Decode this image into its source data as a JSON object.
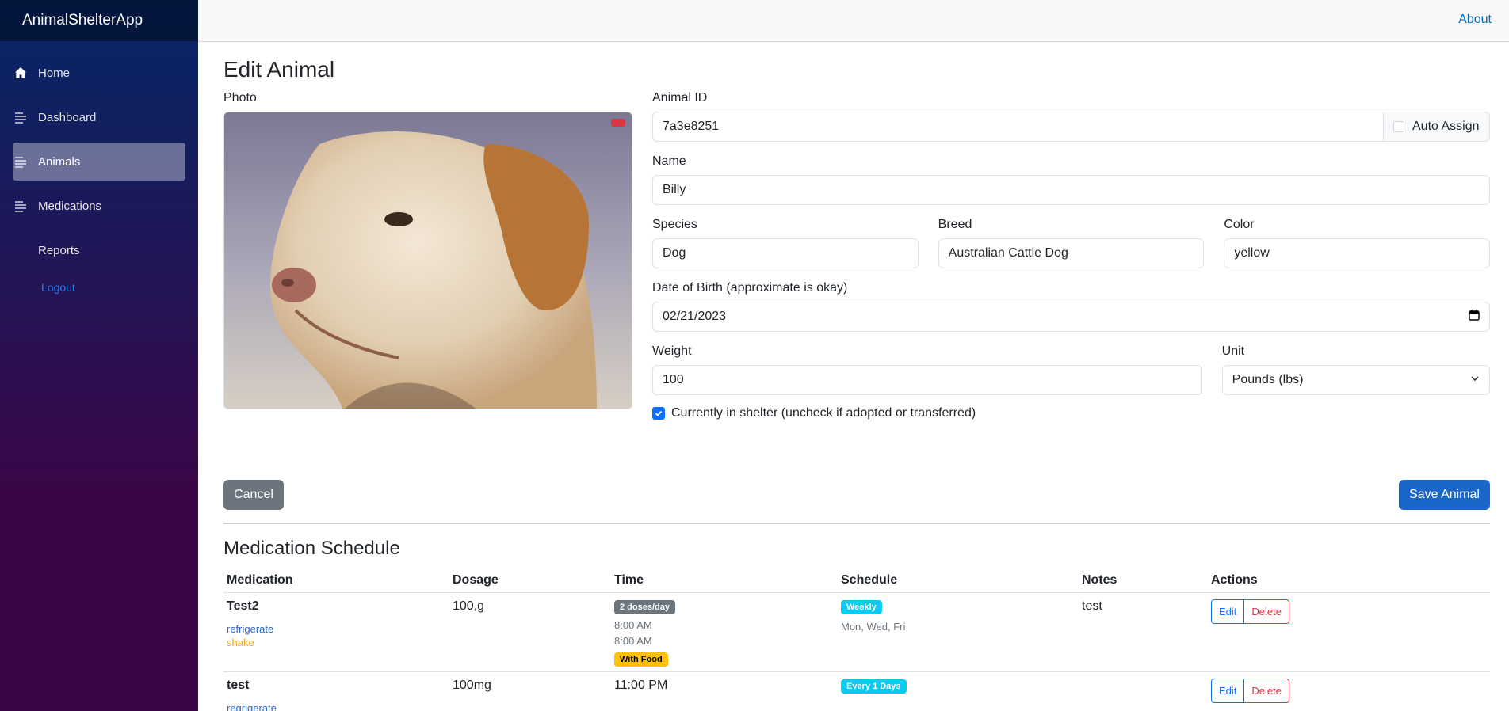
{
  "app": {
    "brand": "AnimalShelterApp"
  },
  "sidebar": {
    "items": [
      {
        "label": "Home",
        "icon": "home-icon"
      },
      {
        "label": "Dashboard",
        "icon": "list-icon"
      },
      {
        "label": "Animals",
        "icon": "list-icon",
        "active": true
      },
      {
        "label": "Medications",
        "icon": "list-icon"
      },
      {
        "label": "Reports",
        "icon": ""
      }
    ],
    "logout": "Logout"
  },
  "topbar": {
    "about": "About"
  },
  "page": {
    "title": "Edit Animal"
  },
  "form": {
    "photo_label": "Photo",
    "animal_id_label": "Animal ID",
    "animal_id_value": "7a3e8251",
    "auto_assign_label": "Auto Assign",
    "name_label": "Name",
    "name_value": "Billy",
    "species_label": "Species",
    "species_value": "Dog",
    "breed_label": "Breed",
    "breed_value": "Australian Cattle Dog",
    "color_label": "Color",
    "color_value": "yellow",
    "dob_label": "Date of Birth (approximate is okay)",
    "dob_value": "02/21/2023",
    "weight_label": "Weight",
    "weight_value": "100",
    "unit_label": "Unit",
    "unit_value": "Pounds (lbs)",
    "in_shelter_label": "Currently in shelter (uncheck if adopted or transferred)",
    "in_shelter_checked": true,
    "cancel_label": "Cancel",
    "save_label": "Save Animal"
  },
  "medications": {
    "title": "Medication Schedule",
    "headers": [
      "Medication",
      "Dosage",
      "Time",
      "Schedule",
      "Notes",
      "Actions"
    ],
    "rows": [
      {
        "name": "Test2",
        "instructions": [
          "refrigerate",
          "shake"
        ],
        "dosage": "100,g",
        "time_badge": "2 doses/day",
        "times": [
          "8:00 AM",
          "8:00 AM"
        ],
        "food_badge": "With Food",
        "schedule_badge": "Weekly",
        "schedule_days": "Mon, Wed, Fri",
        "notes": "test",
        "edit": "Edit",
        "delete": "Delete"
      },
      {
        "name": "test",
        "instructions": [
          "regrigerate"
        ],
        "dosage": "100mg",
        "time": "11:00 PM",
        "schedule_badge": "Every 1 Days",
        "notes": "",
        "edit": "Edit",
        "delete": "Delete"
      }
    ]
  },
  "colors": {
    "primary": "#0d6efd",
    "danger": "#dc3545",
    "secondary": "#6c757d",
    "info": "#0dcaf0",
    "warning": "#ffc107"
  }
}
